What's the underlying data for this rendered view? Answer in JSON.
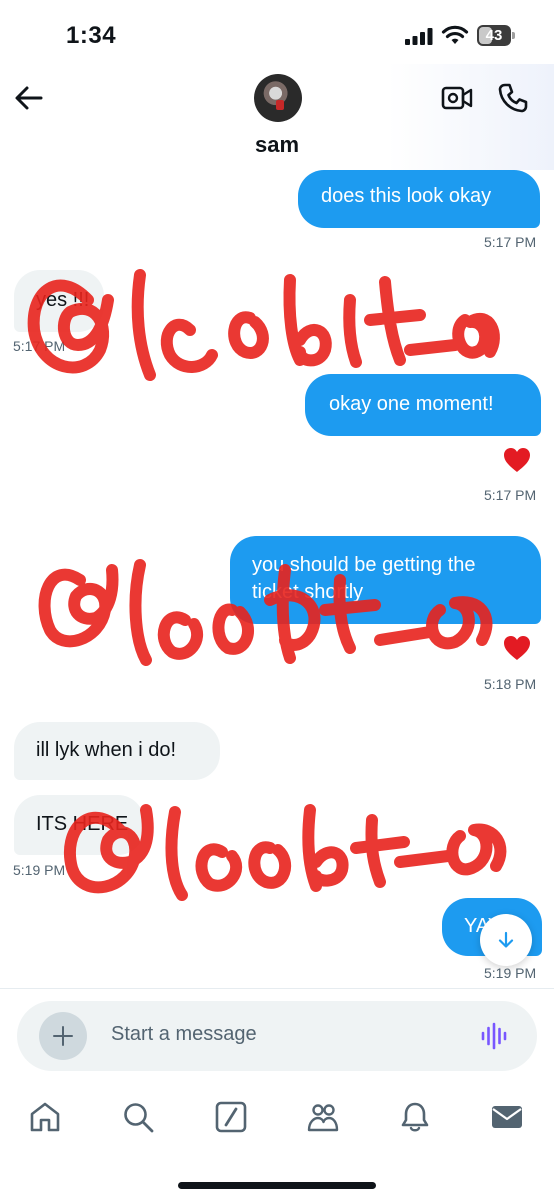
{
  "status_bar": {
    "time": "1:34",
    "battery": "43",
    "battery_level": 0.43
  },
  "header": {
    "contact_name": "sam",
    "back_icon": "arrow-left-icon",
    "video_icon": "video-camera-icon",
    "phone_icon": "phone-icon"
  },
  "messages": [
    {
      "side": "sent",
      "lines": [
        "does this look okay"
      ],
      "time": "5:17 PM"
    },
    {
      "side": "received",
      "lines": [
        "yes !!!"
      ],
      "time": "5:17 PM"
    },
    {
      "side": "sent",
      "lines": [
        "okay one moment!"
      ],
      "reaction": "heart",
      "time": "5:17 PM"
    },
    {
      "side": "sent",
      "lines": [
        "you should be getting the",
        "ticket shortly"
      ],
      "reaction": "heart",
      "time": "5:18 PM"
    },
    {
      "side": "received",
      "lines": [
        "ill lyk when i do!"
      ]
    },
    {
      "side": "received",
      "lines": [
        "ITS HERE"
      ],
      "time": "5:19 PM"
    },
    {
      "side": "sent",
      "lines": [
        "YAY"
      ],
      "time": "5:19 PM"
    }
  ],
  "overlay": {
    "watermark_text": "@leobit_oo"
  },
  "composer": {
    "placeholder": "Start a message"
  },
  "tabs": [
    {
      "name": "home-icon"
    },
    {
      "name": "search-icon"
    },
    {
      "name": "grok-icon"
    },
    {
      "name": "communities-icon"
    },
    {
      "name": "notifications-icon"
    },
    {
      "name": "messages-icon"
    }
  ],
  "colors": {
    "accent": "#1d9bf0",
    "received_bubble": "#eff3f4",
    "reaction_heart": "#f91880",
    "voice_icon": "#7856ff",
    "watermark": "#e8231d"
  }
}
